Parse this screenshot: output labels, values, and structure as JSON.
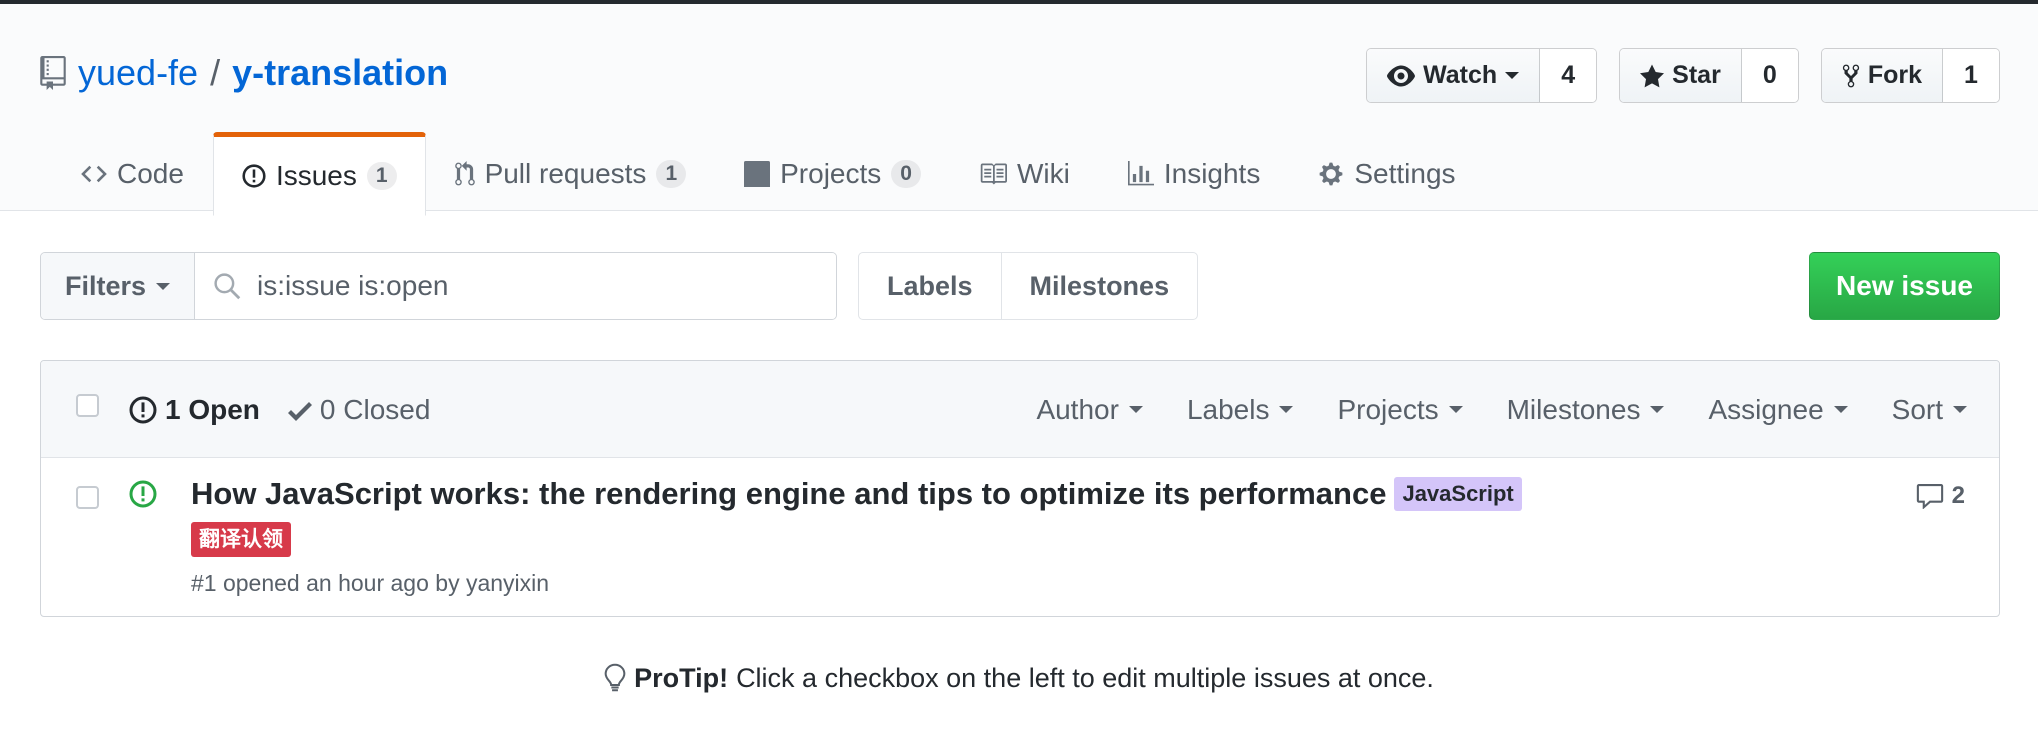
{
  "repo": {
    "owner": "yued-fe",
    "separator": "/",
    "name": "y-translation"
  },
  "actions": {
    "watch": {
      "label": "Watch",
      "count": "4"
    },
    "star": {
      "label": "Star",
      "count": "0"
    },
    "fork": {
      "label": "Fork",
      "count": "1"
    }
  },
  "tabs": [
    {
      "label": "Code",
      "icon": "code-icon"
    },
    {
      "label": "Issues",
      "counter": "1",
      "icon": "issue-opened-icon",
      "selected": true
    },
    {
      "label": "Pull requests",
      "counter": "1",
      "icon": "git-pull-request-icon"
    },
    {
      "label": "Projects",
      "counter": "0",
      "icon": "project-icon"
    },
    {
      "label": "Wiki",
      "icon": "book-icon"
    },
    {
      "label": "Insights",
      "icon": "graph-icon"
    },
    {
      "label": "Settings",
      "icon": "gear-icon"
    }
  ],
  "subnav": {
    "filters_label": "Filters",
    "search_value": "is:issue is:open",
    "labels_label": "Labels",
    "milestones_label": "Milestones",
    "new_issue_label": "New issue"
  },
  "issues_header": {
    "open_label": "1 Open",
    "closed_label": "0 Closed",
    "filters": [
      "Author",
      "Labels",
      "Projects",
      "Milestones",
      "Assignee",
      "Sort"
    ]
  },
  "issues": [
    {
      "title": "How JavaScript works: the rendering engine and tips to optimize its performance",
      "labels": [
        {
          "name": "JavaScript",
          "color": "#d4c5f9"
        },
        {
          "name": "翻译认领",
          "color": "#d73a4a"
        }
      ],
      "meta": "#1 opened an hour ago by yanyixin",
      "comments": "2"
    }
  ],
  "protip": {
    "strong": "ProTip!",
    "text": "Click a checkbox on the left to edit multiple issues at once."
  },
  "colors": {
    "link": "#0366d6",
    "selected_tab_accent": "#e36209",
    "new_issue_green": "#28a745",
    "open_icon_green": "#28a745"
  }
}
